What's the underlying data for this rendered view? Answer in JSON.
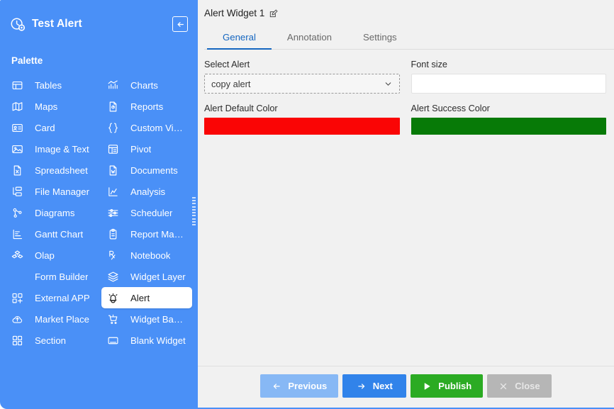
{
  "sidebar": {
    "logo_icon": "dashboard-gauge-icon",
    "title": "Test Alert",
    "back_icon": "arrow-left-icon",
    "palette_label": "Palette",
    "drag_handle_icon": "resize-handle-icon",
    "items": [
      {
        "label": "Tables",
        "icon": "table-icon",
        "selected": false
      },
      {
        "label": "Charts",
        "icon": "bar-chart-icon",
        "selected": false
      },
      {
        "label": "Maps",
        "icon": "map-icon",
        "selected": false
      },
      {
        "label": "Reports",
        "icon": "report-doc-icon",
        "selected": false
      },
      {
        "label": "Card",
        "icon": "id-card-icon",
        "selected": false
      },
      {
        "label": "Custom Visu...",
        "icon": "braces-icon",
        "selected": false
      },
      {
        "label": "Image & Text",
        "icon": "image-text-icon",
        "selected": false
      },
      {
        "label": "Pivot",
        "icon": "pivot-table-icon",
        "selected": false
      },
      {
        "label": "Spreadsheet",
        "icon": "excel-file-icon",
        "selected": false
      },
      {
        "label": "Documents",
        "icon": "word-file-icon",
        "selected": false
      },
      {
        "label": "File Manager",
        "icon": "folder-tree-icon",
        "selected": false
      },
      {
        "label": "Analysis",
        "icon": "analysis-chart-icon",
        "selected": false
      },
      {
        "label": "Diagrams",
        "icon": "nodes-diagram-icon",
        "selected": false
      },
      {
        "label": "Scheduler",
        "icon": "sliders-icon",
        "selected": false
      },
      {
        "label": "Gantt Chart",
        "icon": "gantt-icon",
        "selected": false
      },
      {
        "label": "Report Mana...",
        "icon": "clipboard-icon",
        "selected": false
      },
      {
        "label": "Olap",
        "icon": "cube-stack-icon",
        "selected": false
      },
      {
        "label": "Notebook",
        "icon": "rx-notebook-icon",
        "selected": false
      },
      {
        "label": "Form Builder",
        "icon": "form-doc-icon",
        "selected": false
      },
      {
        "label": "Widget Layer",
        "icon": "layers-icon",
        "selected": false
      },
      {
        "label": "External APP",
        "icon": "grid-plus-icon",
        "selected": false
      },
      {
        "label": "Alert",
        "icon": "bell-alert-icon",
        "selected": true
      },
      {
        "label": "Market Place",
        "icon": "cloud-up-icon",
        "selected": false
      },
      {
        "label": "Widget Basket",
        "icon": "shopping-cart-icon",
        "selected": false
      },
      {
        "label": "Section",
        "icon": "grid-sections-icon",
        "selected": false
      },
      {
        "label": "Blank Widget",
        "icon": "blank-rect-icon",
        "selected": false
      }
    ]
  },
  "panel": {
    "widget_title": "Alert Widget 1",
    "edit_icon": "edit-pencil-icon",
    "tabs": [
      {
        "label": "General",
        "active": true
      },
      {
        "label": "Annotation",
        "active": false
      },
      {
        "label": "Settings",
        "active": false
      }
    ],
    "fields": {
      "select_alert": {
        "label": "Select Alert",
        "value": "copy alert",
        "chevron_icon": "chevron-down-icon"
      },
      "font_size": {
        "label": "Font size",
        "value": "",
        "placeholder": ""
      },
      "alert_default_color": {
        "label": "Alert Default Color",
        "color": "#FA0505"
      },
      "alert_success_color": {
        "label": "Alert Success Color",
        "color": "#077A07"
      }
    },
    "footer_buttons": [
      {
        "label": "Previous",
        "icon": "arrow-left-icon",
        "style": "btn-prev"
      },
      {
        "label": "Next",
        "icon": "arrow-right-icon",
        "style": "btn-next"
      },
      {
        "label": "Publish",
        "icon": "play-icon",
        "style": "btn-publish"
      },
      {
        "label": "Close",
        "icon": "close-x-icon",
        "style": "btn-close"
      }
    ]
  },
  "theme": {
    "sidebar_blue": "#4a90f7",
    "accent_blue": "#1566c0",
    "panel_bg": "#f1f1f1"
  }
}
